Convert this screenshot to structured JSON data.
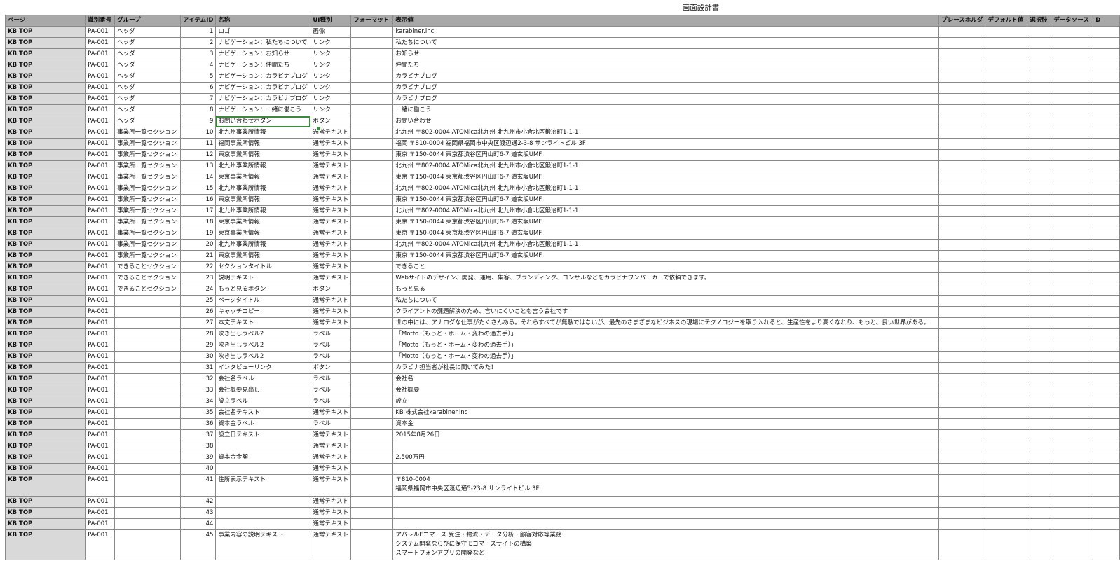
{
  "sheet_title": "画面設計書",
  "columns": [
    "ページ",
    "識別番号",
    "グループ",
    "アイテムID",
    "名称",
    "UI種別",
    "フォーマット",
    "表示値",
    "プレースホルダ",
    "デフォルト値",
    "選択肢",
    "データソース",
    "D"
  ],
  "rows": [
    [
      "KB  TOP",
      "PA-001",
      "ヘッダ",
      "1",
      "ロゴ",
      "画像",
      "",
      "karabiner.inc"
    ],
    [
      "KB  TOP",
      "PA-001",
      "ヘッダ",
      "2",
      "ナビゲーション：私たちについて",
      "リンク",
      "",
      "私たちについて"
    ],
    [
      "KB  TOP",
      "PA-001",
      "ヘッダ",
      "3",
      "ナビゲーション：お知らせ",
      "リンク",
      "",
      "お知らせ"
    ],
    [
      "KB  TOP",
      "PA-001",
      "ヘッダ",
      "4",
      "ナビゲーション：仲間たち",
      "リンク",
      "",
      "仲間たち"
    ],
    [
      "KB  TOP",
      "PA-001",
      "ヘッダ",
      "5",
      "ナビゲーション：カラビナブログ",
      "リンク",
      "",
      "カラビナブログ"
    ],
    [
      "KB  TOP",
      "PA-001",
      "ヘッダ",
      "6",
      "ナビゲーション：カラビナブログ",
      "リンク",
      "",
      "カラビナブログ"
    ],
    [
      "KB  TOP",
      "PA-001",
      "ヘッダ",
      "7",
      "ナビゲーション：カラビナブログ",
      "リンク",
      "",
      "カラビナブログ"
    ],
    [
      "KB  TOP",
      "PA-001",
      "ヘッダ",
      "8",
      "ナビゲーション：一緒に働こう",
      "リンク",
      "",
      "一緒に働こう"
    ],
    [
      "KB  TOP",
      "PA-001",
      "ヘッダ",
      "9",
      "お問い合わせボタン",
      "ボタン",
      "",
      "お問い合わせ"
    ],
    [
      "KB  TOP",
      "PA-001",
      "事業所一覧セクション",
      "10",
      "北九州事業所情報",
      "通常テキスト",
      "",
      "北九州 〒802-0004 ATOMica北九州 北九州市小倉北区鍛冶町1-1-1"
    ],
    [
      "KB  TOP",
      "PA-001",
      "事業所一覧セクション",
      "11",
      "福岡事業所情報",
      "通常テキスト",
      "",
      "福岡 〒810-0004 福岡県福岡市中央区渡辺通2-3-8 サンライトビル 3F"
    ],
    [
      "KB  TOP",
      "PA-001",
      "事業所一覧セクション",
      "12",
      "東京事業所情報",
      "通常テキスト",
      "",
      "東京 〒150-0044 東京都渋谷区円山町6-7 道玄坂UMF"
    ],
    [
      "KB  TOP",
      "PA-001",
      "事業所一覧セクション",
      "13",
      "北九州事業所情報",
      "通常テキスト",
      "",
      "北九州 〒802-0004 ATOMica北九州 北九州市小倉北区鍛冶町1-1-1"
    ],
    [
      "KB  TOP",
      "PA-001",
      "事業所一覧セクション",
      "14",
      "東京事業所情報",
      "通常テキスト",
      "",
      "東京 〒150-0044 東京都渋谷区円山町6-7 道玄坂UMF"
    ],
    [
      "KB  TOP",
      "PA-001",
      "事業所一覧セクション",
      "15",
      "北九州事業所情報",
      "通常テキスト",
      "",
      "北九州 〒802-0004 ATOMica北九州 北九州市小倉北区鍛冶町1-1-1"
    ],
    [
      "KB  TOP",
      "PA-001",
      "事業所一覧セクション",
      "16",
      "東京事業所情報",
      "通常テキスト",
      "",
      "東京 〒150-0044 東京都渋谷区円山町6-7 道玄坂UMF"
    ],
    [
      "KB  TOP",
      "PA-001",
      "事業所一覧セクション",
      "17",
      "北九州事業所情報",
      "通常テキスト",
      "",
      "北九州 〒802-0004 ATOMica北九州 北九州市小倉北区鍛冶町1-1-1"
    ],
    [
      "KB  TOP",
      "PA-001",
      "事業所一覧セクション",
      "18",
      "東京事業所情報",
      "通常テキスト",
      "",
      "東京 〒150-0044 東京都渋谷区円山町6-7 道玄坂UMF"
    ],
    [
      "KB  TOP",
      "PA-001",
      "事業所一覧セクション",
      "19",
      "東京事業所情報",
      "通常テキスト",
      "",
      "東京 〒150-0044 東京都渋谷区円山町6-7 道玄坂UMF"
    ],
    [
      "KB  TOP",
      "PA-001",
      "事業所一覧セクション",
      "20",
      "北九州事業所情報",
      "通常テキスト",
      "",
      "北九州 〒802-0004 ATOMica北九州 北九州市小倉北区鍛冶町1-1-1"
    ],
    [
      "KB  TOP",
      "PA-001",
      "事業所一覧セクション",
      "21",
      "東京事業所情報",
      "通常テキスト",
      "",
      "東京 〒150-0044 東京都渋谷区円山町6-7 道玄坂UMF"
    ],
    [
      "KB  TOP",
      "PA-001",
      "できることセクション",
      "22",
      "セクションタイトル",
      "通常テキスト",
      "",
      "できること"
    ],
    [
      "KB  TOP",
      "PA-001",
      "できることセクション",
      "23",
      "説明テキスト",
      "通常テキスト",
      "",
      "Webサイトのデザイン、開発、運用、集客、ブランディング、コンサルなどをカラビナワンパーカーで依頼できます。"
    ],
    [
      "KB  TOP",
      "PA-001",
      "できることセクション",
      "24",
      "もっと見るボタン",
      "ボタン",
      "",
      "もっと見る"
    ],
    [
      "KB  TOP",
      "PA-001",
      "",
      "25",
      "ページタイトル",
      "通常テキスト",
      "",
      "私たちについて"
    ],
    [
      "KB  TOP",
      "PA-001",
      "",
      "26",
      "キャッチコピー",
      "通常テキスト",
      "",
      "クライアントの課題解決のため、言いにくいことも言う会社です"
    ],
    [
      "KB  TOP",
      "PA-001",
      "",
      "27",
      "本文テキスト",
      "通常テキスト",
      "",
      "世の中には、アナログな仕事がたくさんある。それらすべてが無駄ではないが、最先のさまざまなビジネスの現場にテクノロジーを取り入れると、生産性をより高くなれり、もっと、良い世界がある。"
    ],
    [
      "KB  TOP",
      "PA-001",
      "",
      "28",
      "吹き出しラベル2",
      "ラベル",
      "",
      "「Motto（もっと・ホーム・変わの過去手）」"
    ],
    [
      "KB  TOP",
      "PA-001",
      "",
      "29",
      "吹き出しラベル2",
      "ラベル",
      "",
      "「Motto（もっと・ホーム・変わの過去手）」"
    ],
    [
      "KB  TOP",
      "PA-001",
      "",
      "30",
      "吹き出しラベル2",
      "ラベル",
      "",
      "「Motto（もっと・ホーム・変わの過去手）」"
    ],
    [
      "KB  TOP",
      "PA-001",
      "",
      "31",
      "インタビューリンク",
      "ボタン",
      "",
      "カラビナ担当者が社長に聞いてみた！"
    ],
    [
      "KB  TOP",
      "PA-001",
      "",
      "32",
      "会社名ラベル",
      "ラベル",
      "",
      "会社名"
    ],
    [
      "KB  TOP",
      "PA-001",
      "",
      "33",
      "会社概要見出し",
      "ラベル",
      "",
      "会社概要"
    ],
    [
      "KB  TOP",
      "PA-001",
      "",
      "34",
      "設立ラベル",
      "ラベル",
      "",
      "設立"
    ],
    [
      "KB  TOP",
      "PA-001",
      "",
      "35",
      "会社名テキスト",
      "通常テキスト",
      "",
      "KB 株式会社karabiner.inc"
    ],
    [
      "KB  TOP",
      "PA-001",
      "",
      "36",
      "資本金ラベル",
      "ラベル",
      "",
      "資本金"
    ],
    [
      "KB  TOP",
      "PA-001",
      "",
      "37",
      "設立日テキスト",
      "通常テキスト",
      "",
      "2015年8月26日"
    ],
    [
      "KB  TOP",
      "PA-001",
      "",
      "38",
      "",
      "通常テキスト",
      "",
      ""
    ],
    [
      "KB  TOP",
      "PA-001",
      "",
      "39",
      "資本金金額",
      "通常テキスト",
      "",
      "2,500万円"
    ],
    [
      "KB  TOP",
      "PA-001",
      "",
      "40",
      "",
      "通常テキスト",
      "",
      ""
    ],
    [
      "KB  TOP",
      "PA-001",
      "",
      "41",
      "住所表示テキスト",
      "通常テキスト",
      "",
      "〒810-0004\n福岡県福岡市中央区渡辺通5-23-8 サンライトビル 3F"
    ],
    [
      "KB  TOP",
      "PA-001",
      "",
      "42",
      "",
      "通常テキスト",
      "",
      ""
    ],
    [
      "KB  TOP",
      "PA-001",
      "",
      "43",
      "",
      "通常テキスト",
      "",
      ""
    ],
    [
      "KB  TOP",
      "PA-001",
      "",
      "44",
      "",
      "通常テキスト",
      "",
      ""
    ],
    [
      "KB  TOP",
      "PA-001",
      "",
      "45",
      "事業内容の説明テキスト",
      "通常テキスト",
      "",
      "アパレルEコマース 受注・物流・データ分析・顧客対応等業務\nシステム開発ならびに保守 Eコマースサイトの構築\nスマートフォンアプリの開発など"
    ]
  ]
}
